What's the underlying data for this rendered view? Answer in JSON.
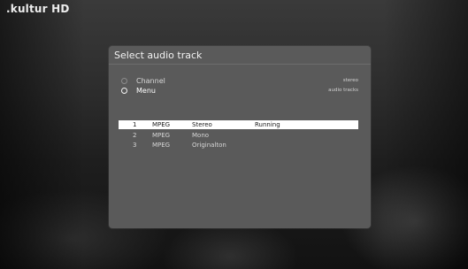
{
  "channel": {
    "logo": ".kultur HD"
  },
  "dialog": {
    "title": "Select audio track",
    "options": [
      {
        "label": "Channel",
        "value": "stereo",
        "selected": false
      },
      {
        "label": "Menu",
        "value": "audio tracks",
        "selected": true
      }
    ],
    "tracks": [
      {
        "number": "1",
        "format": "MPEG",
        "type": "Stereo",
        "status": "Running",
        "selected": true
      },
      {
        "number": "2",
        "format": "MPEG",
        "type": "Mono",
        "status": "",
        "selected": false
      },
      {
        "number": "3",
        "format": "MPEG",
        "type": "Originalton",
        "status": "",
        "selected": false
      }
    ]
  },
  "colors": {
    "panel": "#5a5a5a",
    "highlight": "#ffffff"
  }
}
